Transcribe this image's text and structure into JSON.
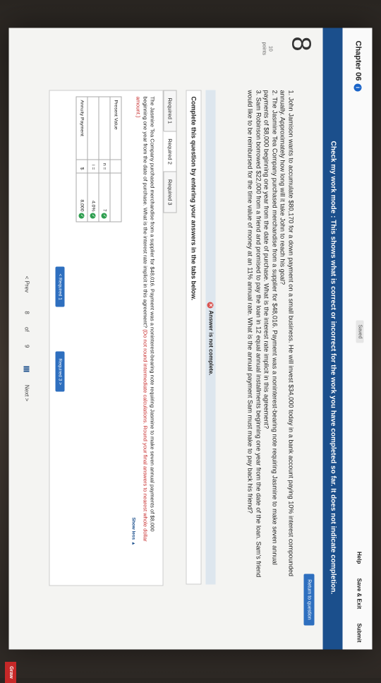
{
  "header": {
    "chapter": "Chapter 06",
    "saved_label": "Saved",
    "help": "Help",
    "save_exit": "Save & Exit",
    "submit": "Submit"
  },
  "mode_bar": "Check my work mode : This shows what is correct or incorrect for the work you have completed so far. It does not indicate completion.",
  "return_button": "Return to question",
  "question": {
    "number": "8",
    "points": "10",
    "points_label": "points",
    "p1": "1. John Jamison wants to accumulate $80,170 for a down payment on a small business. He will invest $34,000 today in a bank account paying 10% interest compounded annually. Approximately how long will it take John to reach his goal?",
    "p2": "2. The Jasmine Tea Company purchased merchandise from a supplier for $48,016. Payment was a noninterest-bearing note requiring Jasmine to make seven annual payments of $8,000 beginning one year from the date of purchase. What is the interest rate implicit in this agreement?",
    "p3": "3. Sam Robinson borrowed $22,000 from a friend and promised to pay the loan in 12 equal annual installments beginning one year from the date of the loan. Sam's friend would like to be reimbursed for the time value of money at an 11% annual rate. What is the annual payment Sam must make to pay back his friend?"
  },
  "alert": "Answer is not complete.",
  "instructions": "Complete this question by entering your answers in the tabs below.",
  "tabs": [
    "Required 1",
    "Required 2",
    "Required 3"
  ],
  "panel": {
    "text": "The Jasmine Tea Company purchased merchandise from a supplier for $48,016. Payment was a noninterest-bearing note requiring Jasmine to make seven annual payments of $8,000 beginning one year from the date of purchase. What is the interest rate implicit in this agreement?",
    "note": "(Do not round intermediate calculations. Round your final answers to nearest whole dollar amount.)",
    "show_less": "Show less ▲",
    "rows": [
      {
        "label": "Present Value",
        "sym": "",
        "value": ""
      },
      {
        "label": "",
        "sym": "n =",
        "value": "7"
      },
      {
        "label": "",
        "sym": "i =",
        "value": "4.0%"
      },
      {
        "label": "Annuity Payment",
        "sym": "$",
        "value": "8,000"
      }
    ]
  },
  "nav": {
    "prev_tab": "< Required 1",
    "next_tab": "Required 3 >"
  },
  "pager": {
    "prev": "< Prev",
    "page": "8",
    "of": "of",
    "total": "9",
    "next": "Next >"
  },
  "logo": "Graw"
}
